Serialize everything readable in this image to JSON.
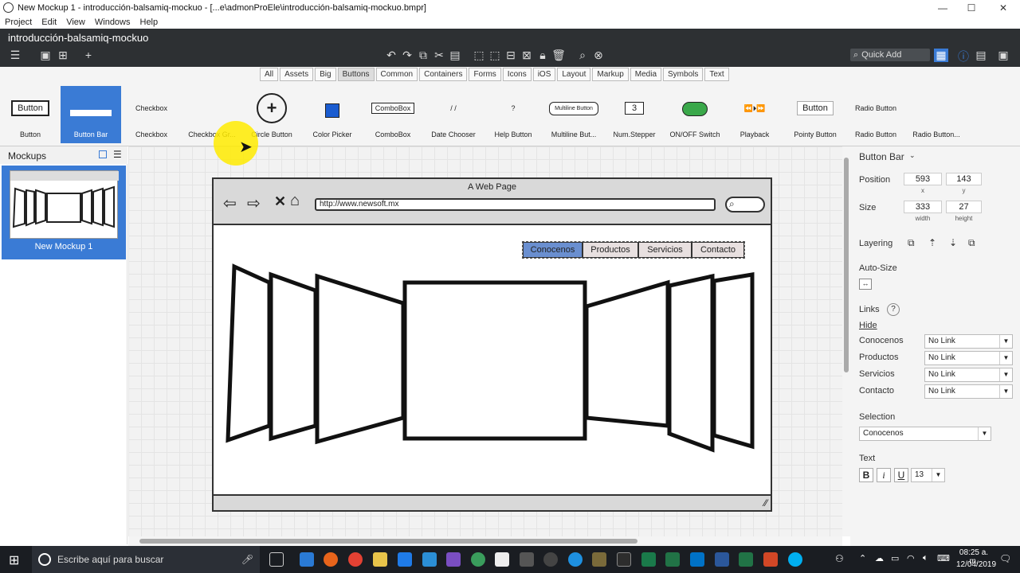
{
  "window": {
    "title": "New Mockup 1 - introducción-balsamiq-mockuo - [...e\\admonProEle\\introducción-balsamiq-mockuo.bmpr]",
    "min": "—",
    "max": "☐",
    "close": "✕"
  },
  "menu": [
    "Project",
    "Edit",
    "View",
    "Windows",
    "Help"
  ],
  "app": {
    "project_name": "introducción-balsamiq-mockuo",
    "quick_add": "Quick Add"
  },
  "library_tabs": [
    "All",
    "Assets",
    "Big",
    "Buttons",
    "Common",
    "Containers",
    "Forms",
    "Icons",
    "iOS",
    "Layout",
    "Markup",
    "Media",
    "Symbols",
    "Text"
  ],
  "library_tabs_selected": "Buttons",
  "library_items": [
    {
      "label": "Button",
      "thumb": "Button"
    },
    {
      "label": "Button Bar",
      "thumb": ""
    },
    {
      "label": "Checkbox",
      "thumb": "Checkbox"
    },
    {
      "label": "Checkbox Gr...",
      "thumb": ""
    },
    {
      "label": "Circle Button",
      "thumb": "+"
    },
    {
      "label": "Color Picker",
      "thumb": ""
    },
    {
      "label": "ComboBox",
      "thumb": "ComboBox"
    },
    {
      "label": "Date Chooser",
      "thumb": "/ /"
    },
    {
      "label": "Help Button",
      "thumb": "?"
    },
    {
      "label": "Multiline But...",
      "thumb": "Multiline Button"
    },
    {
      "label": "Num.Stepper",
      "thumb": "3"
    },
    {
      "label": "ON/OFF Switch",
      "thumb": ""
    },
    {
      "label": "Playback",
      "thumb": "⏪⏵⏩"
    },
    {
      "label": "Pointy Button",
      "thumb": "Button"
    },
    {
      "label": "Radio Button",
      "thumb": "Radio Button"
    },
    {
      "label": "Radio Button...",
      "thumb": ""
    }
  ],
  "mockups_panel": {
    "title": "Mockups",
    "items": [
      {
        "label": "New Mockup 1"
      }
    ]
  },
  "mockup": {
    "browser_title": "A Web Page",
    "url": "http://www.newsoft.mx",
    "nav_buttons": [
      "Conocenos",
      "Productos",
      "Servicios",
      "Contacto"
    ],
    "nav_selected": "Conocenos"
  },
  "inspector": {
    "title": "Button Bar",
    "position_label": "Position",
    "position_x": "593",
    "position_y": "143",
    "x_label": "x",
    "y_label": "y",
    "size_label": "Size",
    "size_w": "333",
    "size_h": "27",
    "w_label": "width",
    "h_label": "height",
    "layering_label": "Layering",
    "autosize_label": "Auto-Size",
    "links_label": "Links",
    "hide_label": "Hide",
    "links": [
      {
        "name": "Conocenos",
        "value": "No Link"
      },
      {
        "name": "Productos",
        "value": "No Link"
      },
      {
        "name": "Servicios",
        "value": "No Link"
      },
      {
        "name": "Contacto",
        "value": "No Link"
      }
    ],
    "selection_label": "Selection",
    "selection_value": "Conocenos",
    "text_label": "Text",
    "font_size": "13",
    "bold": "B",
    "italic": "i",
    "underline": "U"
  },
  "taskbar": {
    "search_placeholder": "Escribe aquí para buscar",
    "time": "08:25 a. m.",
    "date": "12/04/2019"
  },
  "colors": {
    "accent": "#3a7bd5",
    "appbar": "#2d3033",
    "taskbar": "#1a1d22",
    "selected_nav": "#6a8fd0"
  }
}
